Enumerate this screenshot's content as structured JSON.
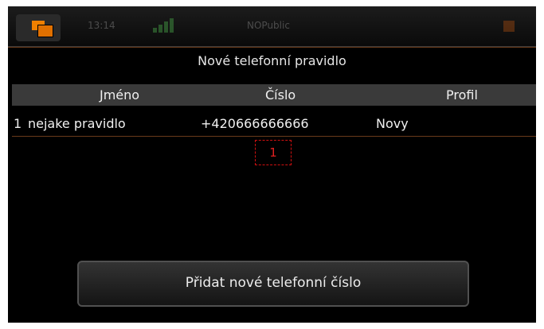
{
  "statusbar": {
    "clock": "13:14",
    "network": "NOPublic"
  },
  "page": {
    "title": "Nové telefonní pravidlo"
  },
  "table": {
    "columns": [
      "Jméno",
      "Číslo",
      "Profil"
    ],
    "rows": [
      {
        "index": "1",
        "name": "nejake pravidlo",
        "number": "+420666666666",
        "profile": "Novy"
      }
    ]
  },
  "badge": {
    "count": "1",
    "color": "#e02020"
  },
  "actions": {
    "add_number": "Přidat nové telefonní číslo"
  },
  "colors": {
    "accent": "#f08000",
    "background": "#000000"
  }
}
